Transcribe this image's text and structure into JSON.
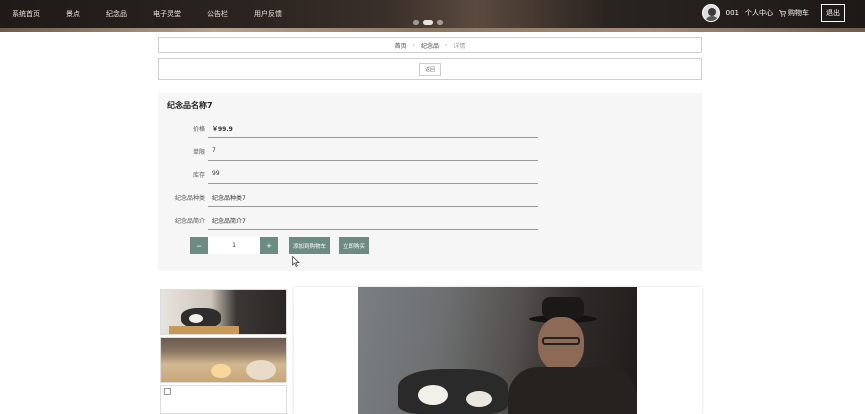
{
  "nav": {
    "items": [
      "系统首页",
      "景点",
      "纪念品",
      "电子灵堂",
      "公告栏",
      "用户反馈"
    ]
  },
  "user": {
    "name": "001",
    "center_label": "个人中心",
    "cart_label": "购物车",
    "logout_label": "退出"
  },
  "breadcrumb": {
    "home": "首页",
    "section": "纪念品",
    "current": "详情",
    "separator": "›"
  },
  "back_label": "返回",
  "product": {
    "title": "纪念品名称7",
    "fields": [
      {
        "label": "价格",
        "value": "￥99.9"
      },
      {
        "label": "单限",
        "value": "7"
      },
      {
        "label": "库存",
        "value": "99"
      },
      {
        "label": "纪念品种类",
        "value": "纪念品种类7"
      },
      {
        "label": "纪念品简介",
        "value": "纪念品简介7"
      }
    ]
  },
  "purchase": {
    "quantity": "1",
    "minus": "−",
    "plus": "+",
    "add_to_cart": "添加到购物车",
    "buy_now": "立即购买"
  },
  "colors": {
    "accent": "#6b8b83",
    "panel_bg": "#f6f6f6"
  }
}
